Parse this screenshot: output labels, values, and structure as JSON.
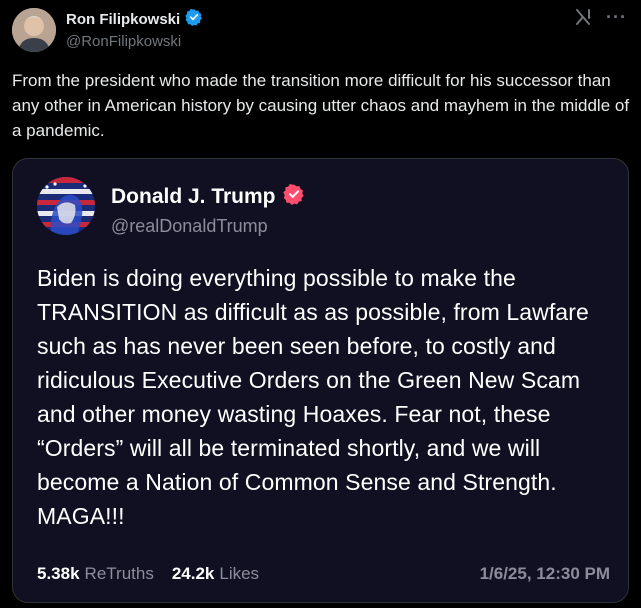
{
  "post": {
    "author": {
      "display_name": "Ron Filipkowski",
      "handle": "@RonFilipkowski",
      "verified": true,
      "verified_color": "#1d9bf0"
    },
    "text": "From the president who made the transition more difficult for his successor than any other in American history by causing utter chaos and mayhem in the middle of a pandemic.",
    "actions": {
      "grok_icon": "grok-icon",
      "more_icon": "more-horizontal-icon"
    }
  },
  "quoted_truth": {
    "author": {
      "display_name": "Donald J. Trump",
      "handle": "@realDonaldTrump",
      "verified": true,
      "verified_color": "#ff4d6d"
    },
    "text": "Biden is doing everything possible to make the TRANSITION as difficult as as possible, from Lawfare such as has never been seen before, to costly and ridiculous Executive Orders on the Green New Scam and other money wasting Hoaxes. Fear not, these “Orders” will all be terminated shortly, and we will become a Nation of Common Sense and Strength. MAGA!!!",
    "stats": {
      "retruths_value": "5.38k",
      "retruths_label": "ReTruths",
      "likes_value": "24.2k",
      "likes_label": "Likes"
    },
    "timestamp": "1/6/25, 12:30 PM"
  },
  "colors": {
    "background": "#000000",
    "card_background": "#111022",
    "border": "#2f3336",
    "muted_text": "#71767b"
  }
}
